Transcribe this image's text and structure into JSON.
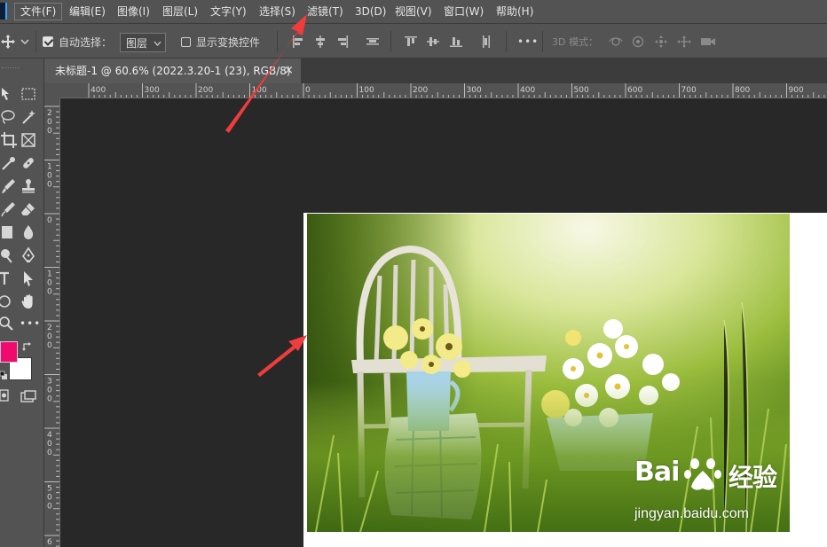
{
  "menu": {
    "items": [
      "文件(F)",
      "编辑(E)",
      "图像(I)",
      "图层(L)",
      "文字(Y)",
      "选择(S)",
      "滤镜(T)",
      "3D(D)",
      "视图(V)",
      "窗口(W)",
      "帮助(H)"
    ]
  },
  "options": {
    "auto_select_label": "自动选择：",
    "auto_select_checked": true,
    "layer_select_value": "图层",
    "show_transform_label": "显示变换控件",
    "more_icon": "•••",
    "mode3d_label": "3D 模式："
  },
  "document": {
    "tab_title": "未标题-1 @ 60.6% (2022.3.20-1 (23), RGB/8)",
    "close_glyph": "×"
  },
  "ruler_h": {
    "labels": [
      "400",
      "300",
      "200",
      "100",
      "0",
      "100",
      "200",
      "300",
      "400",
      "500",
      "600",
      "700",
      "800",
      "900"
    ]
  },
  "ruler_v": {
    "labels": [
      "2\n0\n0",
      "1\n0\n0",
      "0",
      "1\n0\n0",
      "2\n0\n0",
      "3\n0\n0",
      "4\n0\n0",
      "5\n0\n0",
      "6"
    ]
  },
  "watermark": {
    "brand": "Bai",
    "brand_cn": "经验",
    "url": "jingyan.baidu.com"
  },
  "colors": {
    "foreground": "#f0096e",
    "background": "#ffffff",
    "annotation_arrow": "#f03c3c"
  }
}
